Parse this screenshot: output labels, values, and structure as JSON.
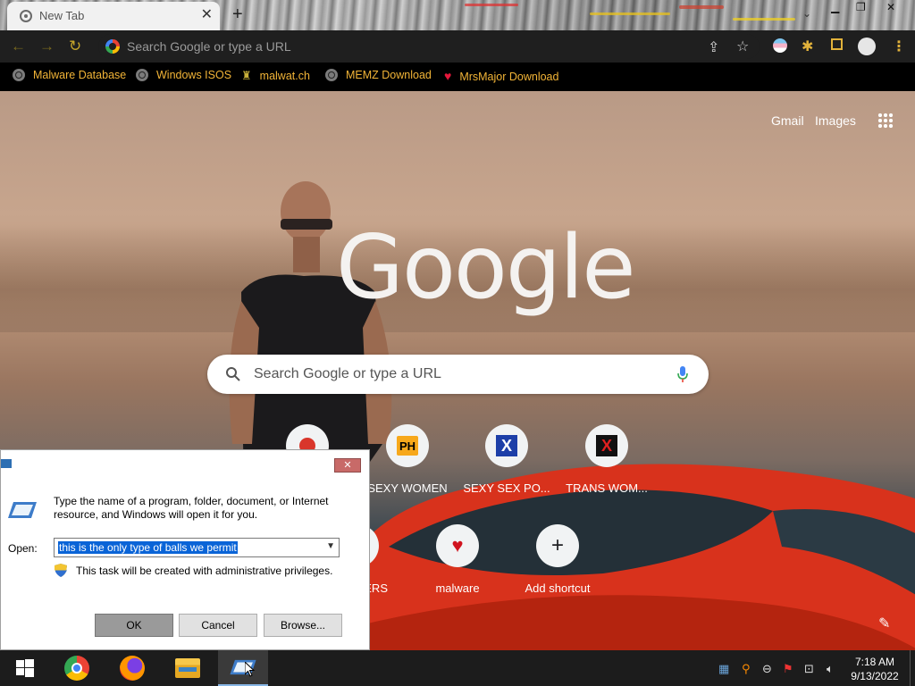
{
  "browser": {
    "tab_title": "New Tab",
    "tab_close": "✕",
    "new_tab": "+",
    "omnibox_placeholder": "Search Google or type a URL"
  },
  "bookmarks": [
    {
      "label": "Malware Database",
      "icon": "globe-icon"
    },
    {
      "label": "Windows ISOS",
      "icon": "globe-icon"
    },
    {
      "label": "malwat.ch",
      "icon": "ghost-icon"
    },
    {
      "label": "MEMZ Download",
      "icon": "globe-icon"
    },
    {
      "label": "MrsMajor Download",
      "icon": "heart-icon"
    }
  ],
  "ntp": {
    "gmail": "Gmail",
    "images": "Images",
    "logo": "Google",
    "search_placeholder": "Search Google or type a URL",
    "shortcuts": [
      {
        "label": "SEXY WOMEN",
        "badge": "PH"
      },
      {
        "label": "SEXY SEX PO...",
        "badge": "X"
      },
      {
        "label": "TRANS WOM...",
        "badge": "X"
      },
      {
        "label": "ERS"
      },
      {
        "label": "malware",
        "badge": "♥"
      },
      {
        "label": "Add shortcut",
        "badge": "+"
      }
    ]
  },
  "run_dialog": {
    "description": "Type the name of a program, folder, document, or Internet resource, and Windows will open it for you.",
    "open_label": "Open:",
    "open_value": "this is the only type of balls we permit",
    "admin_note": "This task will be created with administrative privileges.",
    "ok": "OK",
    "cancel": "Cancel",
    "browse": "Browse...",
    "close": "✕"
  },
  "taskbar": {
    "time": "7:18 AM",
    "date": "9/13/2022"
  },
  "colors": {
    "bookmark_text": "#f2b437",
    "toolbar_bg": "#1f1f1f",
    "selection": "#0a64d7"
  }
}
